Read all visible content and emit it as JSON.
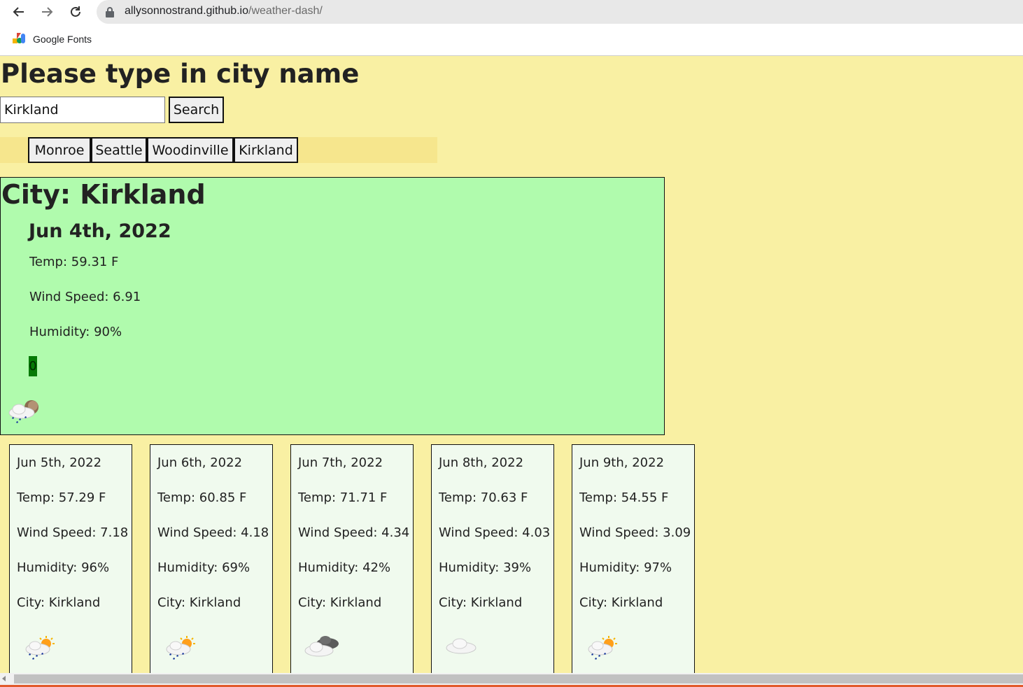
{
  "browser": {
    "url_host": "allysonnostrand.github.io",
    "url_path": "/weather-dash/",
    "back_icon": "back-arrow-icon",
    "forward_icon": "forward-arrow-icon",
    "reload_icon": "reload-icon",
    "bookmarks": [
      {
        "label": "Google Fonts",
        "icon": "google-fonts-icon"
      }
    ]
  },
  "search": {
    "title": "Please type in city name",
    "input_value": "Kirkland",
    "button_label": "Search"
  },
  "history": [
    "Monroe",
    "Seattle",
    "Woodinville",
    "Kirkland"
  ],
  "current": {
    "city_line": "City: Kirkland",
    "date": "Jun 4th, 2022",
    "temp": "Temp: 59.31 F",
    "wind": "Wind Speed: 6.91",
    "humidity": "Humidity: 90%",
    "uv_index": "0",
    "icon": "rain-moon-icon"
  },
  "forecast": [
    {
      "date": "Jun 5th, 2022",
      "temp": "Temp: 57.29 F",
      "wind": "Wind Speed: 7.18",
      "humidity": "Humidity: 96%",
      "city": "City: Kirkland",
      "icon": "rain-sun-icon"
    },
    {
      "date": "Jun 6th, 2022",
      "temp": "Temp: 60.85 F",
      "wind": "Wind Speed: 4.18",
      "humidity": "Humidity: 69%",
      "city": "City: Kirkland",
      "icon": "rain-sun-icon"
    },
    {
      "date": "Jun 7th, 2022",
      "temp": "Temp: 71.71 F",
      "wind": "Wind Speed: 4.34",
      "humidity": "Humidity: 42%",
      "city": "City: Kirkland",
      "icon": "broken-clouds-icon"
    },
    {
      "date": "Jun 8th, 2022",
      "temp": "Temp: 70.63 F",
      "wind": "Wind Speed: 4.03",
      "humidity": "Humidity: 39%",
      "city": "City: Kirkland",
      "icon": "cloud-icon"
    },
    {
      "date": "Jun 9th, 2022",
      "temp": "Temp: 54.55 F",
      "wind": "Wind Speed: 3.09",
      "humidity": "Humidity: 97%",
      "city": "City: Kirkland",
      "icon": "rain-sun-icon"
    }
  ],
  "colors": {
    "page_background": "#f9f0a3",
    "history_bar": "#f6e68d",
    "current_card": "#b0fbad",
    "forecast_card": "#f0faee",
    "uv_badge": "#067a06"
  }
}
